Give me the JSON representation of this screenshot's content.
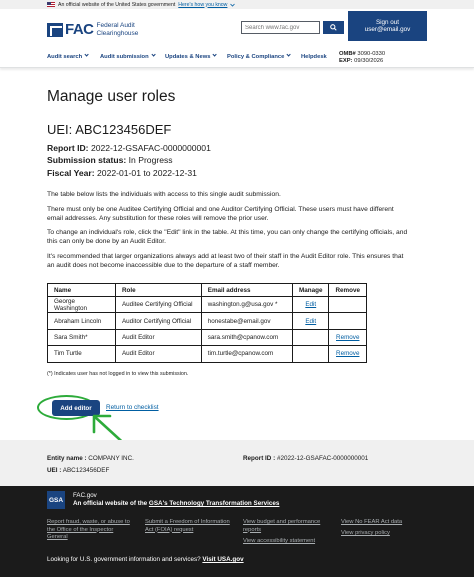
{
  "banner": {
    "text": "An official website of the United States government",
    "howto": "Here's how you know"
  },
  "header": {
    "logo_short": "FAC",
    "logo_name_line1": "Federal Audit",
    "logo_name_line2": "Clearinghouse",
    "search_placeholder": "Search www.fac.gov",
    "signout_line1": "Sign out",
    "signout_line2": "user@email.gov"
  },
  "nav": {
    "items": [
      "Audit search",
      "Audit submission",
      "Updates & News",
      "Policy & Compliance",
      "Helpdesk"
    ],
    "omb_label": "OMB#",
    "omb_value": "3090-0330",
    "exp_label": "EXP:",
    "exp_value": "09/30/2026"
  },
  "page": {
    "title": "Manage user roles",
    "uei_label": "UEI:",
    "uei_value": "ABC123456DEF",
    "report_id_label": "Report ID:",
    "report_id_value": "2022-12-GSAFAC-0000000001",
    "status_label": "Submission status:",
    "status_value": "In Progress",
    "fy_label": "Fiscal Year:",
    "fy_value": "2022-01-01 to 2022-12-31",
    "p1": "The table below lists the individuals with access to this single audit submission.",
    "p2": "There must only be one Auditee Certifying Official and one Auditor Certifying Official. These users must have different email addresses. Any substitution for these roles will remove the prior user.",
    "p3": "To change an individual's role, click the \"Edit\" link in the table. At this time, you can only change the certifying officials, and this can only be done by an Audit Editor.",
    "p4": "It's recommended that larger organizations always add at least two of their staff in the Audit Editor role. This ensures that an audit does not become inaccessible due to the departure of a staff member."
  },
  "table": {
    "headers": [
      "Name",
      "Role",
      "Email address",
      "Manage",
      "Remove"
    ],
    "rows": [
      {
        "name": "George Washington",
        "role": "Auditee Certifying Official",
        "email": "washington.g@usa.gov *",
        "manage": "Edit",
        "remove": ""
      },
      {
        "name": "Abraham Lincoln",
        "role": "Auditor Certifying Official",
        "email": "honestabe@email.gov",
        "manage": "Edit",
        "remove": ""
      },
      {
        "name": "Sara Smith*",
        "role": "Audit Editor",
        "email": "sara.smith@cpanow.com",
        "manage": "",
        "remove": "Remove"
      },
      {
        "name": "Tim Turtle",
        "role": "Audit Editor",
        "email": "tim.turtle@cpanow.com",
        "manage": "",
        "remove": "Remove"
      }
    ],
    "note": "(*) Indicates user has not logged in to view this submission."
  },
  "actions": {
    "add_editor": "Add editor",
    "back": "Return to checklist"
  },
  "summary": {
    "entity_label": "Entity name :",
    "entity_value": "COMPANY INC.",
    "uei_label": "UEI :",
    "uei_value": "ABC123456DEF",
    "report_label": "Report ID :",
    "report_value": "#2022-12-GSAFAC-0000000001"
  },
  "footer": {
    "logo": "GSA",
    "site": "FAC.gov",
    "official_prefix": "An official website of the",
    "official_link": "GSA's Technology Transformation Services",
    "links_col1": "Report fraud, waste, or abuse to the Office of the Inspector General",
    "links_col2": "Submit a Freedom of Information Act (FOIA) request",
    "links_col3a": "View budget and performance reports",
    "links_col3b": "View accessibility statement",
    "links_col4a": "View No FEAR Act data",
    "links_col4b": "View privacy policy",
    "looking": "Looking for U.S. government information and services?",
    "looking_link": "Visit USA.gov"
  },
  "colors": {
    "primary": "#1a4480",
    "link": "#005ea2",
    "highlight": "#2dab3a",
    "footer_bg": "#1b1b1b"
  }
}
